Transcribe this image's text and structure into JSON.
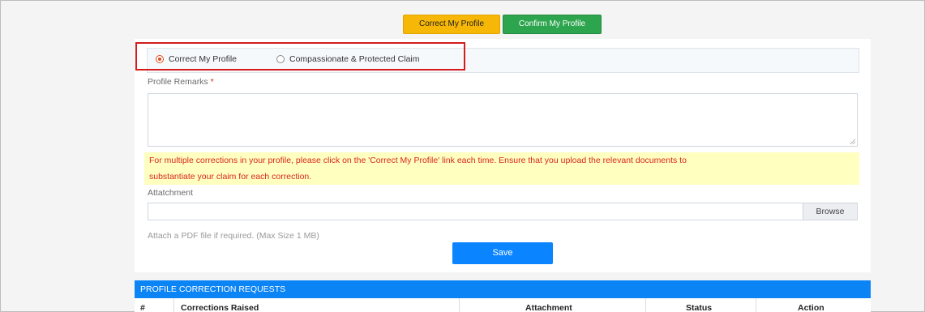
{
  "top_buttons": {
    "correct": "Correct My Profile",
    "confirm": "Confirm My Profile"
  },
  "radios": [
    {
      "label": "Correct My Profile",
      "checked": true
    },
    {
      "label": "Compassionate & Protected Claim",
      "checked": false
    }
  ],
  "remarks": {
    "label": "Profile Remarks",
    "required_mark": "*",
    "value": ""
  },
  "notice": {
    "line1": "For multiple corrections in your profile, please click on the 'Correct My Profile' link each time. Ensure that you upload the relevant documents to",
    "line2": "substantiate your claim for each correction."
  },
  "attachment": {
    "label": "Attatchment",
    "value": "",
    "browse": "Browse",
    "hint": "Attach a PDF file if required. (Max Size 1 MB)"
  },
  "save_label": "Save",
  "table": {
    "title": "PROFILE CORRECTION REQUESTS",
    "columns": [
      "#",
      "Corrections Raised",
      "Attachment",
      "Status",
      "Action"
    ]
  },
  "colors": {
    "accent_blue": "#0a84ff",
    "yellow_button": "#f7b707",
    "green_button": "#2da44e",
    "highlight_red": "#d51b1b",
    "notice_bg": "#ffffc0"
  }
}
